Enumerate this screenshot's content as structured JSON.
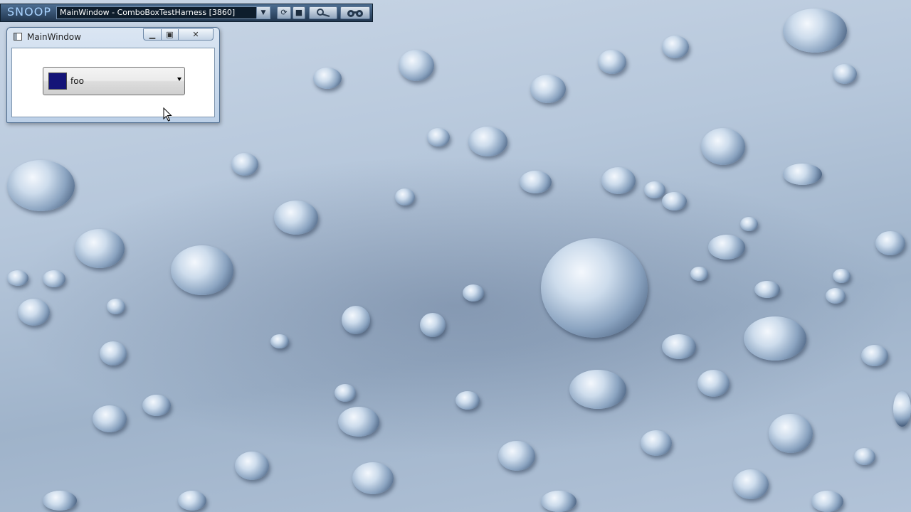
{
  "snoop": {
    "logo": "SNOOP",
    "target": "MainWindow - ComboBoxTestHarness [3860]",
    "icons": [
      "dropdown-arrow-icon",
      "refresh-icon",
      "stop-icon",
      "magnifier-icon",
      "binoculars-icon"
    ]
  },
  "window": {
    "title": "MainWindow",
    "icon": "window-app-icon",
    "caption_buttons": {
      "minimize": "minimize-icon",
      "maximize": "maximize-icon",
      "close": "close-icon"
    }
  },
  "combobox": {
    "selected_text": "foo",
    "swatch_color": "#141478",
    "arrow": "chevron-down-icon"
  },
  "cursor": "arrow-cursor-icon"
}
